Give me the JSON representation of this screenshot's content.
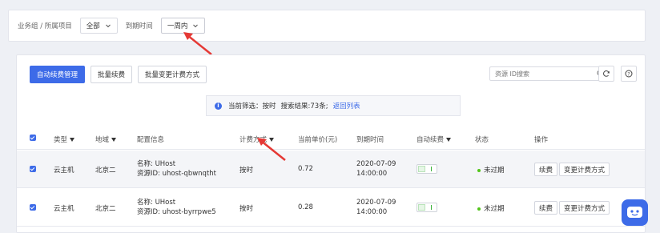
{
  "filter_bar": {
    "project_label": "业务组 / 所属项目",
    "project_value": "全部",
    "expire_label": "到期时间",
    "expire_value": "一周内"
  },
  "toolbar": {
    "auto_renew_manage": "自动续费管理",
    "batch_renew": "批量续费",
    "batch_change_billing": "批量变更计费方式",
    "search_placeholder": "资源 ID搜索"
  },
  "notice": {
    "prefix": "当前筛选：",
    "filter_value": "按时",
    "results": "搜索结果:73条;",
    "back_link": "返回列表"
  },
  "table": {
    "headers": {
      "type": "类型",
      "region": "地域",
      "config": "配置信息",
      "billing": "计费方式",
      "unit_price": "当前单价(元)",
      "expire": "到期时间",
      "auto_renew": "自动续费",
      "status": "状态",
      "actions": "操作"
    },
    "rows": [
      {
        "type": "云主机",
        "region": "北京二",
        "name": "名称: UHost",
        "resource_id": "资源ID: uhost-qbwnqtht",
        "billing": "按时",
        "unit_price": "0.72",
        "expire_date": "2020-07-09",
        "expire_time": "14:00:00",
        "status": "未过期",
        "renew_btn": "续费",
        "change_btn": "变更计费方式"
      },
      {
        "type": "云主机",
        "region": "北京二",
        "name": "名称: UHost",
        "resource_id": "资源ID: uhost-byrrpwe5",
        "billing": "按时",
        "unit_price": "0.28",
        "expire_date": "2020-07-09",
        "expire_time": "14:00:00",
        "status": "未过期",
        "renew_btn": "续费",
        "change_btn": "变更计费方式"
      }
    ]
  },
  "colors": {
    "primary": "#3d6be8",
    "arrow": "#e53935",
    "status_ok": "#52c41a"
  }
}
